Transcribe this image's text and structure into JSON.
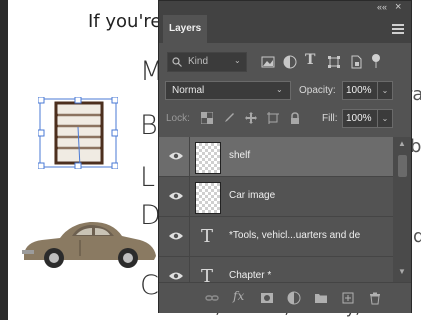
{
  "document": {
    "line_intro": "If you're",
    "letters": [
      "M",
      "B",
      "L",
      "D",
      "C"
    ],
    "fragment_ra": "ra",
    "fragment_b": "b",
    "fragment_id": "ıd",
    "fragment_bottom": "..., kitchen, laundry,"
  },
  "panel": {
    "title": "Layers",
    "collapse_glyph": "««",
    "close_glyph": "×",
    "filter": {
      "placeholder": "Kind",
      "chevron": "⌄"
    },
    "blend_mode": {
      "value": "Normal",
      "chevron": "⌄"
    },
    "opacity": {
      "label": "Opacity:",
      "value": "100%",
      "chevron": "⌄"
    },
    "lock": {
      "label": "Lock:"
    },
    "fill": {
      "label": "Fill:",
      "value": "100%",
      "chevron": "⌄"
    },
    "layers": [
      {
        "name": "shelf",
        "type": "image",
        "visible": true,
        "selected": true
      },
      {
        "name": "Car image",
        "type": "image",
        "visible": true,
        "selected": false
      },
      {
        "name": "*Tools, vehicl...uarters and de",
        "type": "text",
        "visible": true,
        "selected": false
      },
      {
        "name": "Chapter *",
        "type": "text",
        "visible": true,
        "selected": false
      }
    ],
    "scroll_up": "▲",
    "scroll_down": "▼",
    "bottom_icons": [
      "link-icon",
      "fx-icon",
      "mask-icon",
      "adjustment-icon",
      "folder-icon",
      "new-layer-icon",
      "trash-icon"
    ],
    "fx_label": "fx",
    "t_glyph": "T"
  }
}
